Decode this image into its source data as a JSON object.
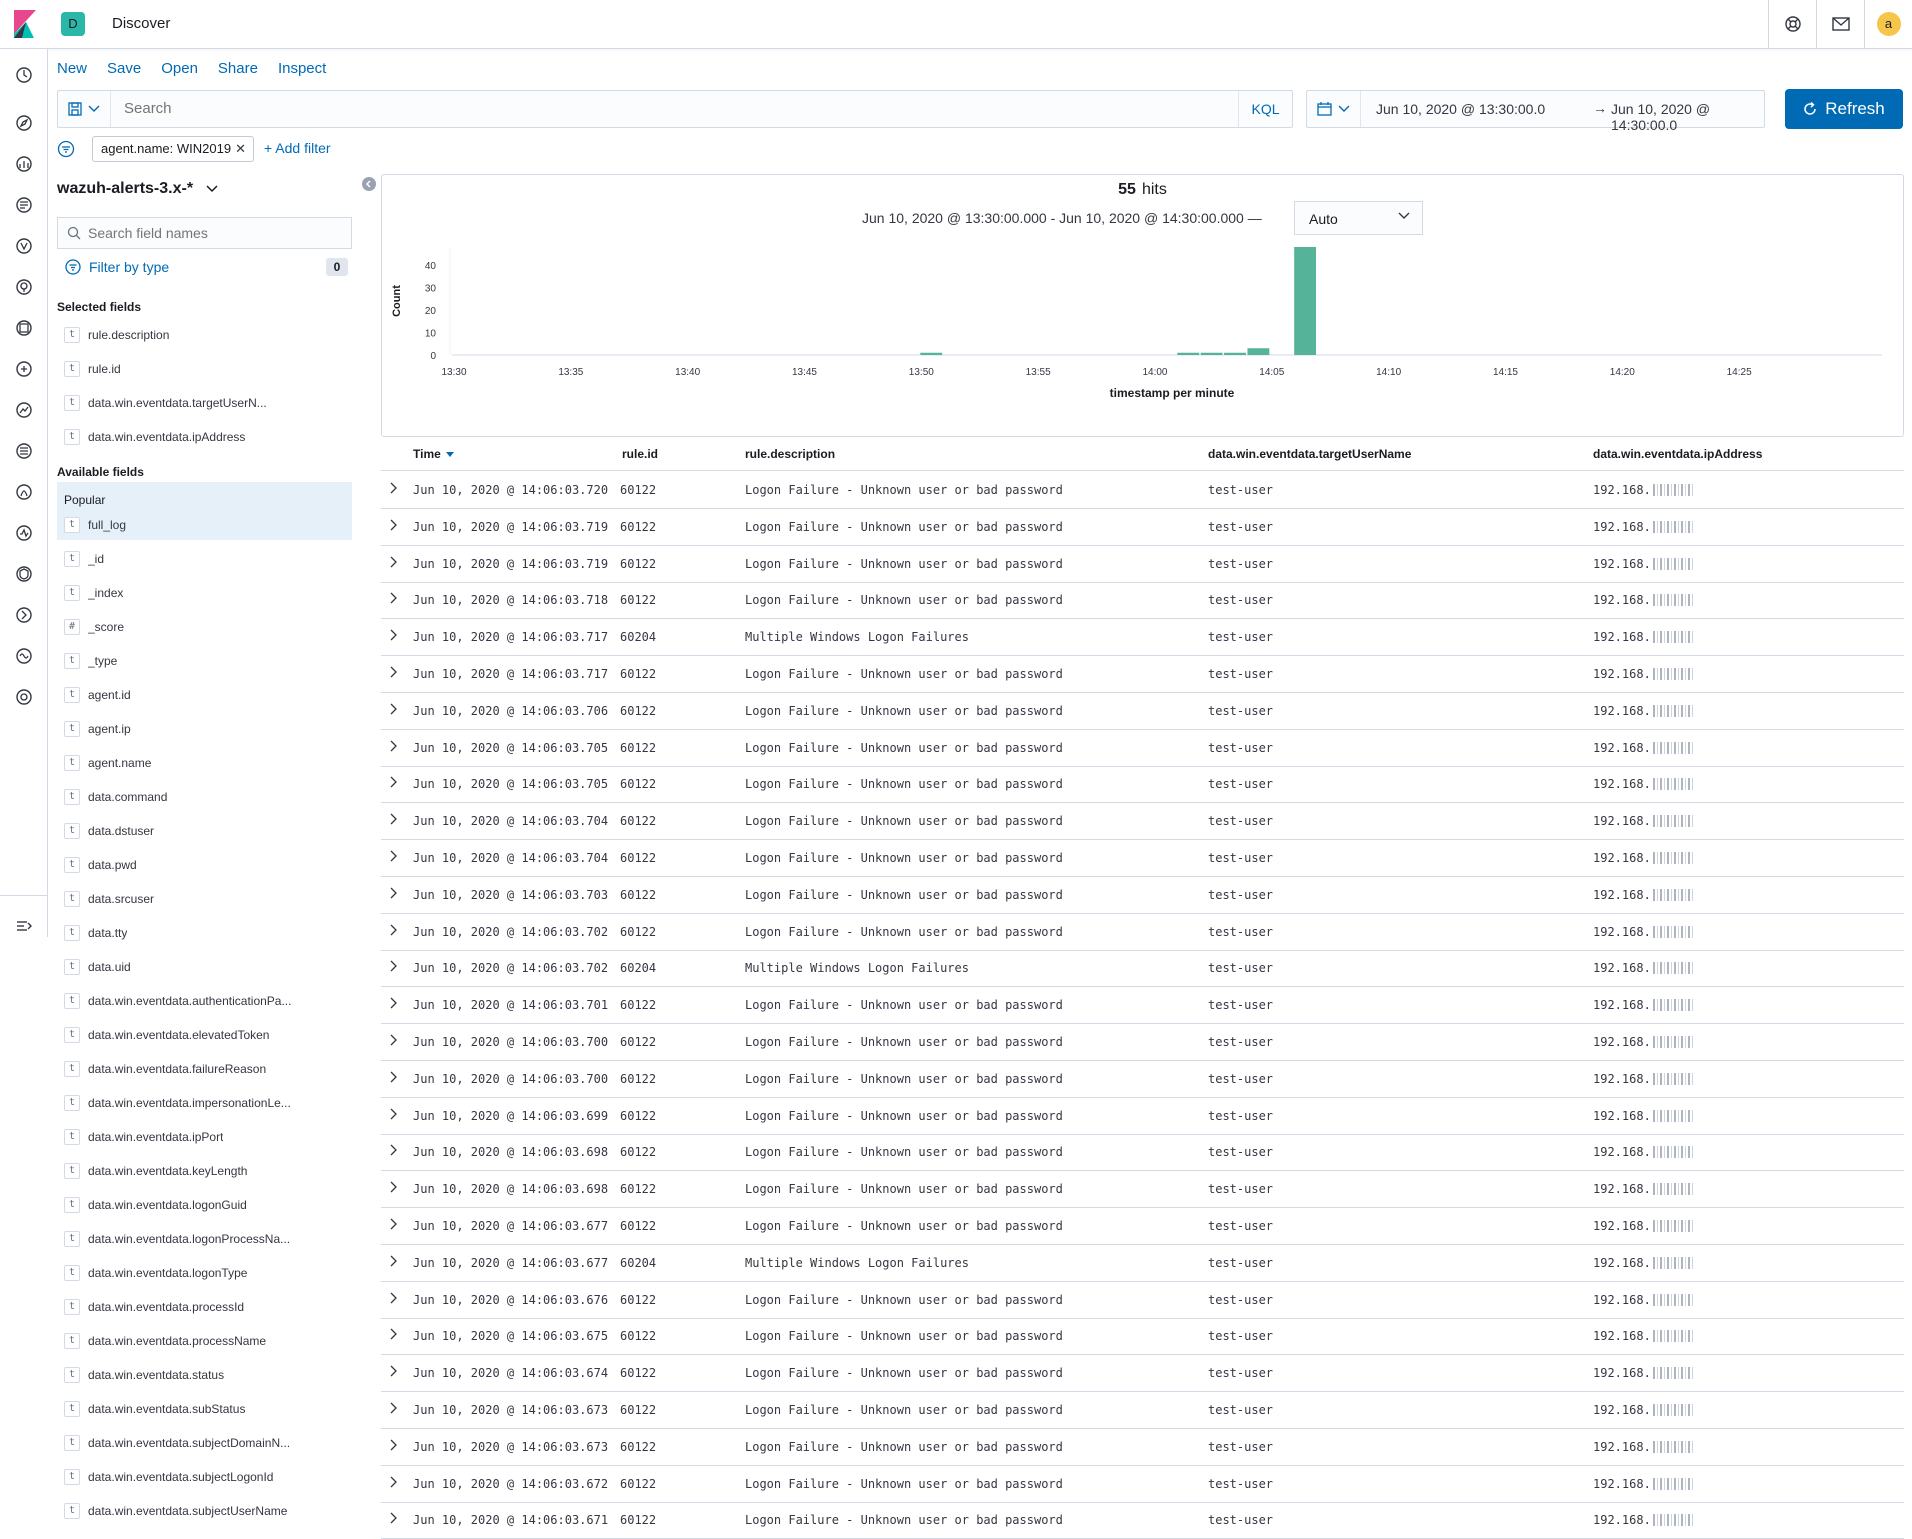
{
  "header": {
    "space_initial": "D",
    "app_title": "Discover",
    "avatar_initial": "a",
    "accent": "#006bb4"
  },
  "left_nav": [
    {
      "name": "recently-viewed-icon"
    },
    {
      "name": "discover-icon"
    },
    {
      "name": "visualize-icon"
    },
    {
      "name": "dashboard-icon"
    },
    {
      "name": "wazuh-icon"
    },
    {
      "name": "maps-icon"
    },
    {
      "name": "canvas-icon"
    },
    {
      "name": "ml-icon"
    },
    {
      "name": "metrics-icon"
    },
    {
      "name": "logs-icon"
    },
    {
      "name": "apm-icon"
    },
    {
      "name": "uptime-icon"
    },
    {
      "name": "siem-icon"
    },
    {
      "name": "dev-tools-icon"
    },
    {
      "name": "monitoring-icon"
    },
    {
      "name": "management-icon"
    }
  ],
  "top_menu": [
    "New",
    "Save",
    "Open",
    "Share",
    "Inspect"
  ],
  "query": {
    "placeholder": "Search",
    "language": "KQL"
  },
  "time_range": {
    "start": "Jun 10, 2020 @ 13:30:00.0",
    "arrow": "→",
    "end": "Jun 10, 2020 @ 14:30:00.0",
    "refresh_label": "Refresh"
  },
  "filters": {
    "pill": "agent.name: WIN2019",
    "add_label": "+ Add filter"
  },
  "sidebar": {
    "index_pattern": "wazuh-alerts-3.x-*",
    "search_placeholder": "Search field names",
    "filter_by_type": "Filter by type",
    "filter_count": "0",
    "selected_title": "Selected fields",
    "selected_fields": [
      {
        "type": "t",
        "name": "rule.description"
      },
      {
        "type": "t",
        "name": "rule.id"
      },
      {
        "type": "t",
        "name": "data.win.eventdata.targetUserN..."
      },
      {
        "type": "t",
        "name": "data.win.eventdata.ipAddress"
      }
    ],
    "available_title": "Available fields",
    "popular_label": "Popular",
    "popular_fields": [
      {
        "type": "t",
        "name": "full_log"
      }
    ],
    "available_fields": [
      {
        "type": "t",
        "name": "_id"
      },
      {
        "type": "t",
        "name": "_index"
      },
      {
        "type": "#",
        "name": "_score"
      },
      {
        "type": "t",
        "name": "_type"
      },
      {
        "type": "t",
        "name": "agent.id"
      },
      {
        "type": "t",
        "name": "agent.ip"
      },
      {
        "type": "t",
        "name": "agent.name"
      },
      {
        "type": "t",
        "name": "data.command"
      },
      {
        "type": "t",
        "name": "data.dstuser"
      },
      {
        "type": "t",
        "name": "data.pwd"
      },
      {
        "type": "t",
        "name": "data.srcuser"
      },
      {
        "type": "t",
        "name": "data.tty"
      },
      {
        "type": "t",
        "name": "data.uid"
      },
      {
        "type": "t",
        "name": "data.win.eventdata.authenticationPa..."
      },
      {
        "type": "t",
        "name": "data.win.eventdata.elevatedToken"
      },
      {
        "type": "t",
        "name": "data.win.eventdata.failureReason"
      },
      {
        "type": "t",
        "name": "data.win.eventdata.impersonationLe..."
      },
      {
        "type": "t",
        "name": "data.win.eventdata.ipPort"
      },
      {
        "type": "t",
        "name": "data.win.eventdata.keyLength"
      },
      {
        "type": "t",
        "name": "data.win.eventdata.logonGuid"
      },
      {
        "type": "t",
        "name": "data.win.eventdata.logonProcessNa..."
      },
      {
        "type": "t",
        "name": "data.win.eventdata.logonType"
      },
      {
        "type": "t",
        "name": "data.win.eventdata.processId"
      },
      {
        "type": "t",
        "name": "data.win.eventdata.processName"
      },
      {
        "type": "t",
        "name": "data.win.eventdata.status"
      },
      {
        "type": "t",
        "name": "data.win.eventdata.subStatus"
      },
      {
        "type": "t",
        "name": "data.win.eventdata.subjectDomainN..."
      },
      {
        "type": "t",
        "name": "data.win.eventdata.subjectLogonId"
      },
      {
        "type": "t",
        "name": "data.win.eventdata.subjectUserName"
      }
    ]
  },
  "histogram": {
    "hits_count": "55",
    "hits_label": "hits",
    "range_text": "Jun 10, 2020 @ 13:30:00.000 - Jun 10, 2020 @ 14:30:00.000 —",
    "interval": "Auto"
  },
  "chart_data": {
    "type": "bar",
    "xlabel": "timestamp per minute",
    "ylabel": "Count",
    "x_ticks": [
      "13:30",
      "13:35",
      "13:40",
      "13:45",
      "13:50",
      "13:55",
      "14:00",
      "14:05",
      "14:10",
      "14:15",
      "14:20",
      "14:25"
    ],
    "x_tick_minutes": [
      0,
      5,
      10,
      15,
      20,
      25,
      30,
      35,
      40,
      45,
      50,
      55
    ],
    "y_ticks": [
      0,
      10,
      20,
      30,
      40
    ],
    "ylim": [
      0,
      48
    ],
    "bar_color": "#54b399",
    "bars": [
      {
        "minute": 20,
        "value": 1
      },
      {
        "minute": 31,
        "value": 1
      },
      {
        "minute": 32,
        "value": 1
      },
      {
        "minute": 33,
        "value": 1
      },
      {
        "minute": 34,
        "value": 3
      },
      {
        "minute": 36,
        "value": 48
      }
    ]
  },
  "table": {
    "columns": [
      "Time",
      "rule.id",
      "rule.description",
      "data.win.eventdata.targetUserName",
      "data.win.eventdata.ipAddress"
    ],
    "rows": [
      {
        "time": "Jun 10, 2020 @ 14:06:03.720",
        "id": "60122",
        "desc": "Logon Failure - Unknown user or bad password",
        "user": "test-user",
        "ip": "192.168."
      },
      {
        "time": "Jun 10, 2020 @ 14:06:03.719",
        "id": "60122",
        "desc": "Logon Failure - Unknown user or bad password",
        "user": "test-user",
        "ip": "192.168."
      },
      {
        "time": "Jun 10, 2020 @ 14:06:03.719",
        "id": "60122",
        "desc": "Logon Failure - Unknown user or bad password",
        "user": "test-user",
        "ip": "192.168."
      },
      {
        "time": "Jun 10, 2020 @ 14:06:03.718",
        "id": "60122",
        "desc": "Logon Failure - Unknown user or bad password",
        "user": "test-user",
        "ip": "192.168."
      },
      {
        "time": "Jun 10, 2020 @ 14:06:03.717",
        "id": "60204",
        "desc": "Multiple Windows Logon Failures",
        "user": "test-user",
        "ip": "192.168."
      },
      {
        "time": "Jun 10, 2020 @ 14:06:03.717",
        "id": "60122",
        "desc": "Logon Failure - Unknown user or bad password",
        "user": "test-user",
        "ip": "192.168."
      },
      {
        "time": "Jun 10, 2020 @ 14:06:03.706",
        "id": "60122",
        "desc": "Logon Failure - Unknown user or bad password",
        "user": "test-user",
        "ip": "192.168."
      },
      {
        "time": "Jun 10, 2020 @ 14:06:03.705",
        "id": "60122",
        "desc": "Logon Failure - Unknown user or bad password",
        "user": "test-user",
        "ip": "192.168."
      },
      {
        "time": "Jun 10, 2020 @ 14:06:03.705",
        "id": "60122",
        "desc": "Logon Failure - Unknown user or bad password",
        "user": "test-user",
        "ip": "192.168."
      },
      {
        "time": "Jun 10, 2020 @ 14:06:03.704",
        "id": "60122",
        "desc": "Logon Failure - Unknown user or bad password",
        "user": "test-user",
        "ip": "192.168."
      },
      {
        "time": "Jun 10, 2020 @ 14:06:03.704",
        "id": "60122",
        "desc": "Logon Failure - Unknown user or bad password",
        "user": "test-user",
        "ip": "192.168."
      },
      {
        "time": "Jun 10, 2020 @ 14:06:03.703",
        "id": "60122",
        "desc": "Logon Failure - Unknown user or bad password",
        "user": "test-user",
        "ip": "192.168."
      },
      {
        "time": "Jun 10, 2020 @ 14:06:03.702",
        "id": "60122",
        "desc": "Logon Failure - Unknown user or bad password",
        "user": "test-user",
        "ip": "192.168."
      },
      {
        "time": "Jun 10, 2020 @ 14:06:03.702",
        "id": "60204",
        "desc": "Multiple Windows Logon Failures",
        "user": "test-user",
        "ip": "192.168."
      },
      {
        "time": "Jun 10, 2020 @ 14:06:03.701",
        "id": "60122",
        "desc": "Logon Failure - Unknown user or bad password",
        "user": "test-user",
        "ip": "192.168."
      },
      {
        "time": "Jun 10, 2020 @ 14:06:03.700",
        "id": "60122",
        "desc": "Logon Failure - Unknown user or bad password",
        "user": "test-user",
        "ip": "192.168."
      },
      {
        "time": "Jun 10, 2020 @ 14:06:03.700",
        "id": "60122",
        "desc": "Logon Failure - Unknown user or bad password",
        "user": "test-user",
        "ip": "192.168."
      },
      {
        "time": "Jun 10, 2020 @ 14:06:03.699",
        "id": "60122",
        "desc": "Logon Failure - Unknown user or bad password",
        "user": "test-user",
        "ip": "192.168."
      },
      {
        "time": "Jun 10, 2020 @ 14:06:03.698",
        "id": "60122",
        "desc": "Logon Failure - Unknown user or bad password",
        "user": "test-user",
        "ip": "192.168."
      },
      {
        "time": "Jun 10, 2020 @ 14:06:03.698",
        "id": "60122",
        "desc": "Logon Failure - Unknown user or bad password",
        "user": "test-user",
        "ip": "192.168."
      },
      {
        "time": "Jun 10, 2020 @ 14:06:03.677",
        "id": "60122",
        "desc": "Logon Failure - Unknown user or bad password",
        "user": "test-user",
        "ip": "192.168."
      },
      {
        "time": "Jun 10, 2020 @ 14:06:03.677",
        "id": "60204",
        "desc": "Multiple Windows Logon Failures",
        "user": "test-user",
        "ip": "192.168."
      },
      {
        "time": "Jun 10, 2020 @ 14:06:03.676",
        "id": "60122",
        "desc": "Logon Failure - Unknown user or bad password",
        "user": "test-user",
        "ip": "192.168."
      },
      {
        "time": "Jun 10, 2020 @ 14:06:03.675",
        "id": "60122",
        "desc": "Logon Failure - Unknown user or bad password",
        "user": "test-user",
        "ip": "192.168."
      },
      {
        "time": "Jun 10, 2020 @ 14:06:03.674",
        "id": "60122",
        "desc": "Logon Failure - Unknown user or bad password",
        "user": "test-user",
        "ip": "192.168."
      },
      {
        "time": "Jun 10, 2020 @ 14:06:03.673",
        "id": "60122",
        "desc": "Logon Failure - Unknown user or bad password",
        "user": "test-user",
        "ip": "192.168."
      },
      {
        "time": "Jun 10, 2020 @ 14:06:03.673",
        "id": "60122",
        "desc": "Logon Failure - Unknown user or bad password",
        "user": "test-user",
        "ip": "192.168."
      },
      {
        "time": "Jun 10, 2020 @ 14:06:03.672",
        "id": "60122",
        "desc": "Logon Failure - Unknown user or bad password",
        "user": "test-user",
        "ip": "192.168."
      },
      {
        "time": "Jun 10, 2020 @ 14:06:03.671",
        "id": "60122",
        "desc": "Logon Failure - Unknown user or bad password",
        "user": "test-user",
        "ip": "192.168."
      }
    ]
  }
}
